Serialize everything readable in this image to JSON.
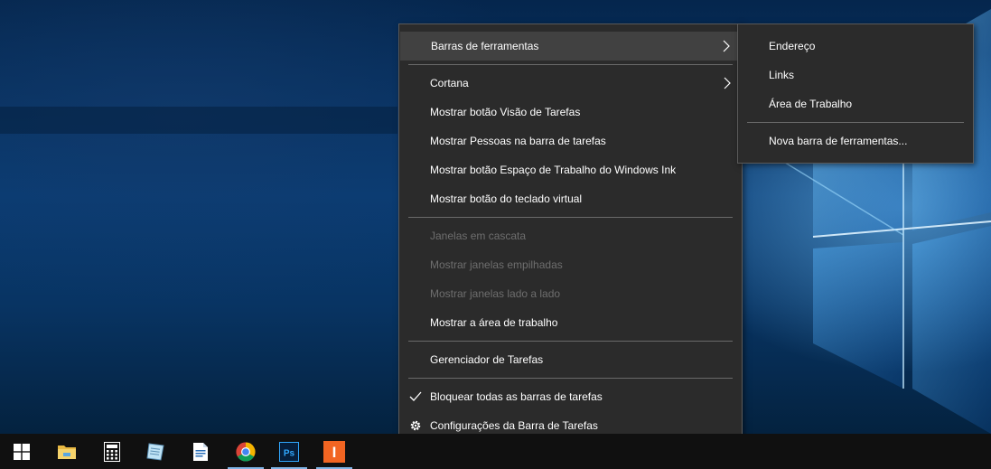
{
  "context_menu": {
    "items": [
      {
        "label": "Barras de ferramentas",
        "enabled": true,
        "has_submenu": true,
        "highlighted": true
      },
      {
        "label": "Cortana",
        "enabled": true,
        "has_submenu": true
      },
      {
        "label": "Mostrar botão Visão de Tarefas",
        "enabled": true
      },
      {
        "label": "Mostrar Pessoas na barra de tarefas",
        "enabled": true
      },
      {
        "label": "Mostrar botão Espaço de Trabalho do Windows Ink",
        "enabled": true
      },
      {
        "label": "Mostrar botão do teclado virtual",
        "enabled": true
      },
      {
        "label": "Janelas em cascata",
        "enabled": false
      },
      {
        "label": "Mostrar janelas empilhadas",
        "enabled": false
      },
      {
        "label": "Mostrar janelas lado a lado",
        "enabled": false
      },
      {
        "label": "Mostrar a área de trabalho",
        "enabled": true
      },
      {
        "label": "Gerenciador de Tarefas",
        "enabled": true
      },
      {
        "label": "Bloquear todas as barras de tarefas",
        "enabled": true,
        "checked": true,
        "icon": "checkmark-icon"
      },
      {
        "label": "Configurações da Barra de Tarefas",
        "enabled": true,
        "icon": "gear-icon"
      }
    ]
  },
  "submenu": {
    "items": [
      {
        "label": "Endereço"
      },
      {
        "label": "Links"
      },
      {
        "label": "Área de Trabalho"
      },
      {
        "label": "Nova barra de ferramentas..."
      }
    ]
  },
  "taskbar": {
    "buttons": [
      {
        "icon": "windows-start-icon",
        "running": false
      },
      {
        "icon": "file-explorer-icon",
        "running": false
      },
      {
        "icon": "calculator-icon",
        "running": false
      },
      {
        "icon": "notepad-icon",
        "running": false
      },
      {
        "icon": "document-editor-icon",
        "running": false
      },
      {
        "icon": "chrome-icon",
        "running": true
      },
      {
        "icon": "photoshop-icon",
        "running": true,
        "text": "Ps"
      },
      {
        "icon": "orange-i-app-icon",
        "running": true,
        "text": "I"
      }
    ]
  },
  "colors": {
    "menu_bg": "#2b2b2b",
    "menu_hover": "#414141",
    "disabled_text": "#6e6e6e",
    "taskbar_bg": "#101010",
    "running_indicator": "#7fb4e6"
  }
}
